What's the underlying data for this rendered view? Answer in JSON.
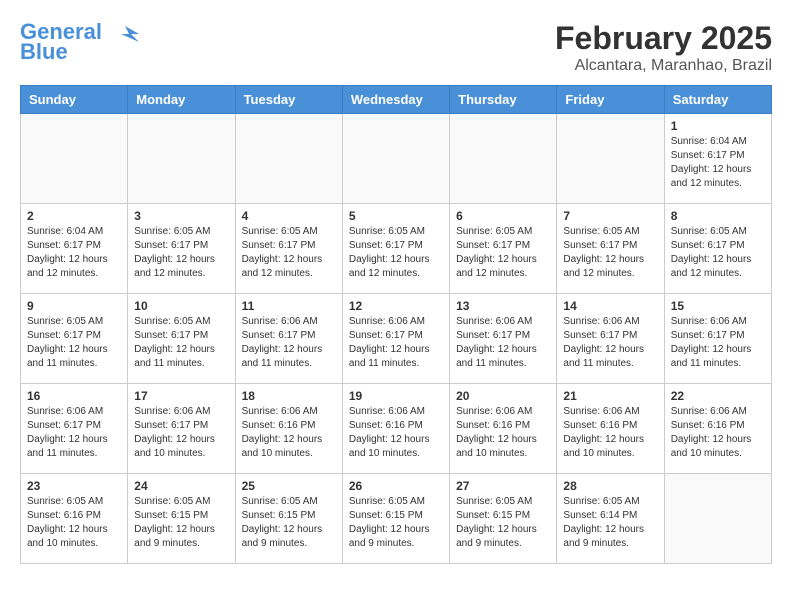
{
  "logo": {
    "line1": "General",
    "line2": "Blue"
  },
  "title": "February 2025",
  "subtitle": "Alcantara, Maranhao, Brazil",
  "days_of_week": [
    "Sunday",
    "Monday",
    "Tuesday",
    "Wednesday",
    "Thursday",
    "Friday",
    "Saturday"
  ],
  "weeks": [
    [
      {
        "day": "",
        "info": ""
      },
      {
        "day": "",
        "info": ""
      },
      {
        "day": "",
        "info": ""
      },
      {
        "day": "",
        "info": ""
      },
      {
        "day": "",
        "info": ""
      },
      {
        "day": "",
        "info": ""
      },
      {
        "day": "1",
        "info": "Sunrise: 6:04 AM\nSunset: 6:17 PM\nDaylight: 12 hours\nand 12 minutes."
      }
    ],
    [
      {
        "day": "2",
        "info": "Sunrise: 6:04 AM\nSunset: 6:17 PM\nDaylight: 12 hours\nand 12 minutes."
      },
      {
        "day": "3",
        "info": "Sunrise: 6:05 AM\nSunset: 6:17 PM\nDaylight: 12 hours\nand 12 minutes."
      },
      {
        "day": "4",
        "info": "Sunrise: 6:05 AM\nSunset: 6:17 PM\nDaylight: 12 hours\nand 12 minutes."
      },
      {
        "day": "5",
        "info": "Sunrise: 6:05 AM\nSunset: 6:17 PM\nDaylight: 12 hours\nand 12 minutes."
      },
      {
        "day": "6",
        "info": "Sunrise: 6:05 AM\nSunset: 6:17 PM\nDaylight: 12 hours\nand 12 minutes."
      },
      {
        "day": "7",
        "info": "Sunrise: 6:05 AM\nSunset: 6:17 PM\nDaylight: 12 hours\nand 12 minutes."
      },
      {
        "day": "8",
        "info": "Sunrise: 6:05 AM\nSunset: 6:17 PM\nDaylight: 12 hours\nand 12 minutes."
      }
    ],
    [
      {
        "day": "9",
        "info": "Sunrise: 6:05 AM\nSunset: 6:17 PM\nDaylight: 12 hours\nand 11 minutes."
      },
      {
        "day": "10",
        "info": "Sunrise: 6:05 AM\nSunset: 6:17 PM\nDaylight: 12 hours\nand 11 minutes."
      },
      {
        "day": "11",
        "info": "Sunrise: 6:06 AM\nSunset: 6:17 PM\nDaylight: 12 hours\nand 11 minutes."
      },
      {
        "day": "12",
        "info": "Sunrise: 6:06 AM\nSunset: 6:17 PM\nDaylight: 12 hours\nand 11 minutes."
      },
      {
        "day": "13",
        "info": "Sunrise: 6:06 AM\nSunset: 6:17 PM\nDaylight: 12 hours\nand 11 minutes."
      },
      {
        "day": "14",
        "info": "Sunrise: 6:06 AM\nSunset: 6:17 PM\nDaylight: 12 hours\nand 11 minutes."
      },
      {
        "day": "15",
        "info": "Sunrise: 6:06 AM\nSunset: 6:17 PM\nDaylight: 12 hours\nand 11 minutes."
      }
    ],
    [
      {
        "day": "16",
        "info": "Sunrise: 6:06 AM\nSunset: 6:17 PM\nDaylight: 12 hours\nand 11 minutes."
      },
      {
        "day": "17",
        "info": "Sunrise: 6:06 AM\nSunset: 6:17 PM\nDaylight: 12 hours\nand 10 minutes."
      },
      {
        "day": "18",
        "info": "Sunrise: 6:06 AM\nSunset: 6:16 PM\nDaylight: 12 hours\nand 10 minutes."
      },
      {
        "day": "19",
        "info": "Sunrise: 6:06 AM\nSunset: 6:16 PM\nDaylight: 12 hours\nand 10 minutes."
      },
      {
        "day": "20",
        "info": "Sunrise: 6:06 AM\nSunset: 6:16 PM\nDaylight: 12 hours\nand 10 minutes."
      },
      {
        "day": "21",
        "info": "Sunrise: 6:06 AM\nSunset: 6:16 PM\nDaylight: 12 hours\nand 10 minutes."
      },
      {
        "day": "22",
        "info": "Sunrise: 6:06 AM\nSunset: 6:16 PM\nDaylight: 12 hours\nand 10 minutes."
      }
    ],
    [
      {
        "day": "23",
        "info": "Sunrise: 6:05 AM\nSunset: 6:16 PM\nDaylight: 12 hours\nand 10 minutes."
      },
      {
        "day": "24",
        "info": "Sunrise: 6:05 AM\nSunset: 6:15 PM\nDaylight: 12 hours\nand 9 minutes."
      },
      {
        "day": "25",
        "info": "Sunrise: 6:05 AM\nSunset: 6:15 PM\nDaylight: 12 hours\nand 9 minutes."
      },
      {
        "day": "26",
        "info": "Sunrise: 6:05 AM\nSunset: 6:15 PM\nDaylight: 12 hours\nand 9 minutes."
      },
      {
        "day": "27",
        "info": "Sunrise: 6:05 AM\nSunset: 6:15 PM\nDaylight: 12 hours\nand 9 minutes."
      },
      {
        "day": "28",
        "info": "Sunrise: 6:05 AM\nSunset: 6:14 PM\nDaylight: 12 hours\nand 9 minutes."
      },
      {
        "day": "",
        "info": ""
      }
    ]
  ]
}
